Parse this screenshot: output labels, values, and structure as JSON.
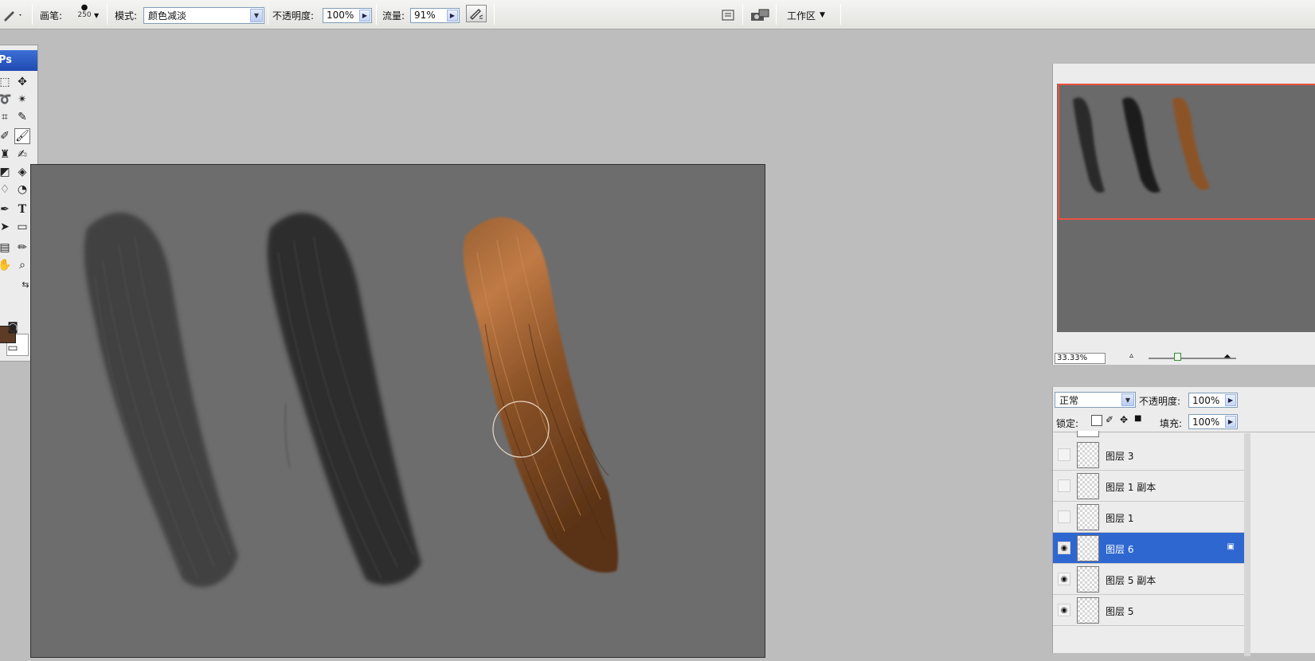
{
  "options_bar": {
    "brush_label": "画笔:",
    "brush_size": "250",
    "mode_label": "模式:",
    "mode_value": "颜色减淡",
    "opacity_label": "不透明度:",
    "opacity_value": "100%",
    "flow_label": "流量:",
    "flow_value": "91%",
    "workspace_label": "工作区"
  },
  "toolbox": {
    "title": "Ps",
    "foreground_color": "#5e3b24",
    "background_color": "#ffffff"
  },
  "navigator": {
    "zoom": "33.33%"
  },
  "layers": {
    "blend_mode": "正常",
    "opacity_label": "不透明度:",
    "opacity_value": "100%",
    "lock_label": "锁定:",
    "fill_label": "填充:",
    "fill_value": "100%",
    "items": [
      {
        "name": "图层 3",
        "visible": false,
        "selected": false
      },
      {
        "name": "图层 1 副本",
        "visible": false,
        "selected": false
      },
      {
        "name": "图层 1",
        "visible": false,
        "selected": false
      },
      {
        "name": "图层 6",
        "visible": true,
        "selected": true
      },
      {
        "name": "图层 5 副本",
        "visible": true,
        "selected": false
      },
      {
        "name": "图层 5",
        "visible": true,
        "selected": false
      }
    ]
  },
  "icons": [
    "brush-icon",
    "airbrush-icon",
    "palette-icon",
    "file-browser-icon",
    "workspace-icon"
  ],
  "colors": {
    "selection": "#2e67d0",
    "navigator_frame": "#e9523f",
    "canvas": "#6d6d6d"
  }
}
